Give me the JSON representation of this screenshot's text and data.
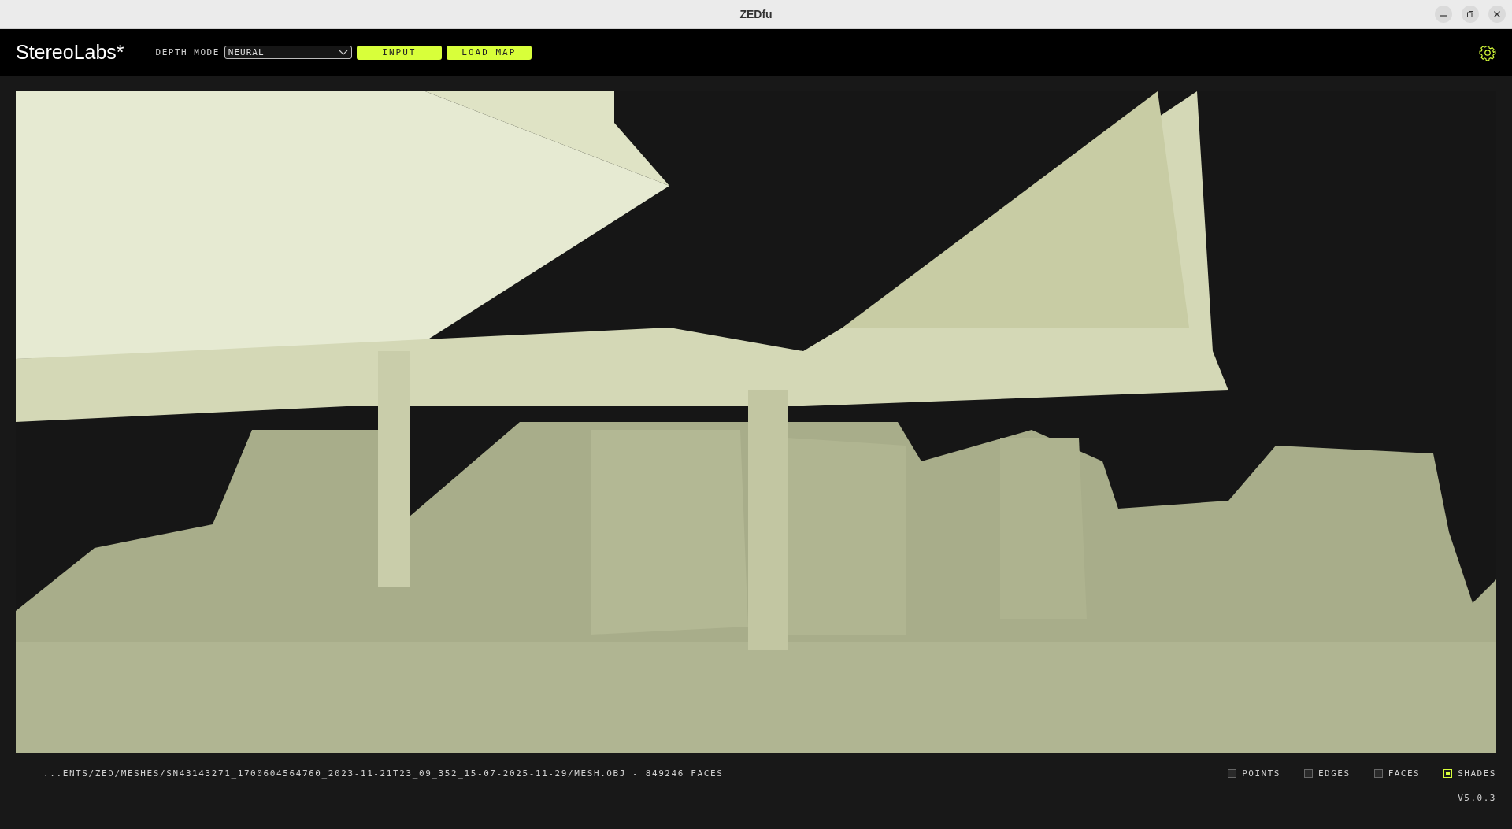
{
  "window": {
    "title": "ZEDfu"
  },
  "header": {
    "logo": "StereoLabs*",
    "depth_mode": {
      "label": "DEPTH MODE",
      "value": "NEURAL"
    },
    "buttons": [
      "INPUT",
      "LOAD MAP"
    ]
  },
  "status": {
    "path": "...ENTS/ZED/MESHES/SN43143271_1700604564760_2023-11-21T23_09_352_15-07-2025-11-29/MESH.OBJ - 849246 FACES",
    "version": "V5.0.3"
  },
  "view_options": [
    {
      "label": "POINTS",
      "checked": false
    },
    {
      "label": "EDGES",
      "checked": false
    },
    {
      "label": "FACES",
      "checked": false
    },
    {
      "label": "SHADES",
      "checked": true
    }
  ]
}
